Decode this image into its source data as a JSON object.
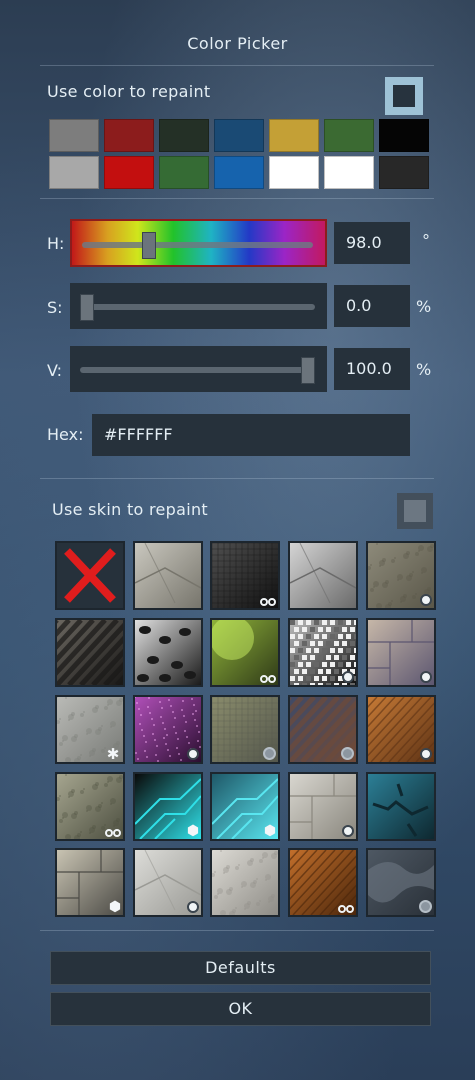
{
  "title": "Color Picker",
  "repaint_color": {
    "label": "Use color to repaint",
    "checked": true
  },
  "swatches": [
    "#7d7d7d",
    "#8c1c1c",
    "#243026",
    "#1a4a74",
    "#c4a036",
    "#3b6a32",
    "#050505",
    "#a8a8a8",
    "#c30f0f",
    "#356b34",
    "#1663ad",
    "#ffffff",
    "#ffffff",
    "#282828"
  ],
  "hsv": {
    "h": {
      "label": "H:",
      "value": "98.0",
      "unit": "°",
      "fraction": 0.272
    },
    "s": {
      "label": "S:",
      "value": "0.0",
      "unit": "%",
      "fraction": 0.0
    },
    "v": {
      "label": "V:",
      "value": "100.0",
      "unit": "%",
      "fraction": 1.0
    }
  },
  "hex": {
    "label": "Hex:",
    "value": "#FFFFFF"
  },
  "repaint_skin": {
    "label": "Use skin to repaint",
    "checked": false
  },
  "skins": [
    {
      "name": "none",
      "badge": ""
    },
    {
      "name": "skin-2",
      "badge": ""
    },
    {
      "name": "skin-3",
      "badge": "link"
    },
    {
      "name": "skin-4",
      "badge": ""
    },
    {
      "name": "skin-5",
      "badge": "dot"
    },
    {
      "name": "skin-6",
      "badge": ""
    },
    {
      "name": "skin-7",
      "badge": ""
    },
    {
      "name": "skin-8",
      "badge": "link"
    },
    {
      "name": "skin-9",
      "badge": "dot"
    },
    {
      "name": "skin-10",
      "badge": "dot"
    },
    {
      "name": "skin-11",
      "badge": "snow"
    },
    {
      "name": "skin-12",
      "badge": "dot"
    },
    {
      "name": "skin-13",
      "badge": "dim"
    },
    {
      "name": "skin-14",
      "badge": "dim"
    },
    {
      "name": "skin-15",
      "badge": "dot"
    },
    {
      "name": "skin-16",
      "badge": "link"
    },
    {
      "name": "skin-17",
      "badge": "cube"
    },
    {
      "name": "skin-18",
      "badge": "cube"
    },
    {
      "name": "skin-19",
      "badge": "dot"
    },
    {
      "name": "skin-20",
      "badge": ""
    },
    {
      "name": "skin-21",
      "badge": "cube"
    },
    {
      "name": "skin-22",
      "badge": "dot"
    },
    {
      "name": "skin-23",
      "badge": ""
    },
    {
      "name": "skin-24",
      "badge": "link"
    },
    {
      "name": "skin-25",
      "badge": "dim"
    }
  ],
  "buttons": {
    "defaults": "Defaults",
    "ok": "OK"
  }
}
